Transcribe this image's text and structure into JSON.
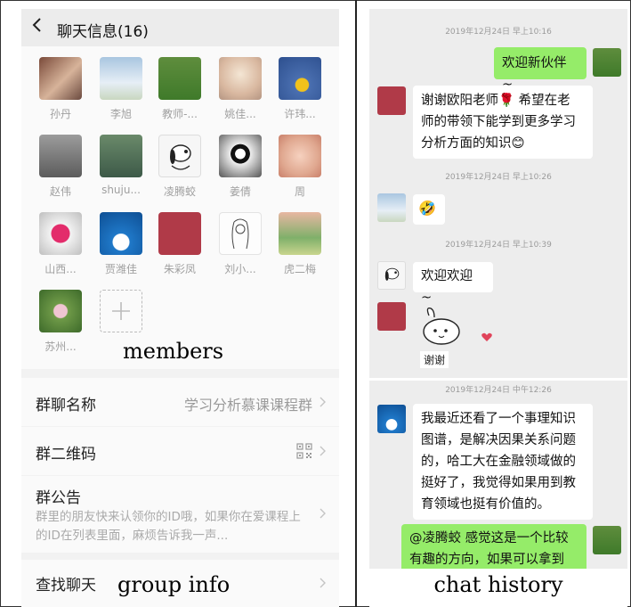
{
  "group_panel": {
    "header_title": "聊天信息(16)",
    "members": [
      {
        "name": "孙丹"
      },
      {
        "name": "李旭"
      },
      {
        "name": "教师-..."
      },
      {
        "name": "姚佳..."
      },
      {
        "name": "许玮..."
      },
      {
        "name": "赵伟"
      },
      {
        "name": "shuju..."
      },
      {
        "name": "凌腾蛟"
      },
      {
        "name": "姜倩"
      },
      {
        "name": "周"
      },
      {
        "name": "山西..."
      },
      {
        "name": "贾潍佳"
      },
      {
        "name": "朱彩凤"
      },
      {
        "name": "刘小..."
      },
      {
        "name": "虎二梅"
      },
      {
        "name": "苏州..."
      }
    ],
    "members_caption": "members",
    "rows": {
      "group_name_label": "群聊名称",
      "group_name_value": "学习分析慕课课程群",
      "qr_label": "群二维码",
      "announcement_label": "群公告",
      "announcement_text": "群里的朋友快来认领你的ID哦，如果你在爱课程上的ID在列表里面，麻烦告诉我一声...",
      "search_label": "查找聊天"
    },
    "group_info_caption": "group info"
  },
  "chat_panel": {
    "timestamps": [
      "2019年12月24日 早上10:16",
      "2019年12月24日 早上10:26",
      "2019年12月24日 早上10:39",
      "2019年12月24日 中午12:26"
    ],
    "messages": {
      "welcome": "欢迎新伙伴 ~",
      "thanks_line1": "谢谢欧阳老师🌹 希望在老",
      "thanks_line2": "师的带领下能学到更多学习",
      "thanks_line3": "分析方面的知识😊",
      "emoji_reply": "🤣",
      "welcome2": "欢迎欢迎 ~",
      "sticker_text": "谢谢",
      "long_line1": "我最近还看了一个事理知识",
      "long_line2": "图谱，是解决因果关系问题",
      "long_line3": "的，哈工大在金融领域做的",
      "long_line4": "挺好了，我觉得如果用到教",
      "long_line5": "育领域也挺有价值的。",
      "reply_line1": "@凌腾蛟 感觉这是一个比较",
      "reply_line2": "有趣的方向，如果可以拿到"
    },
    "chat_history_caption": "chat history"
  },
  "icons": [
    "back-chevron-icon",
    "add-member-icon",
    "qr-code-icon",
    "chevron-right-icon",
    "heart-icon"
  ],
  "colors": {
    "sent_bubble": "#95ec69",
    "received_bubble": "#ffffff",
    "panel_bg": "#ededed"
  }
}
